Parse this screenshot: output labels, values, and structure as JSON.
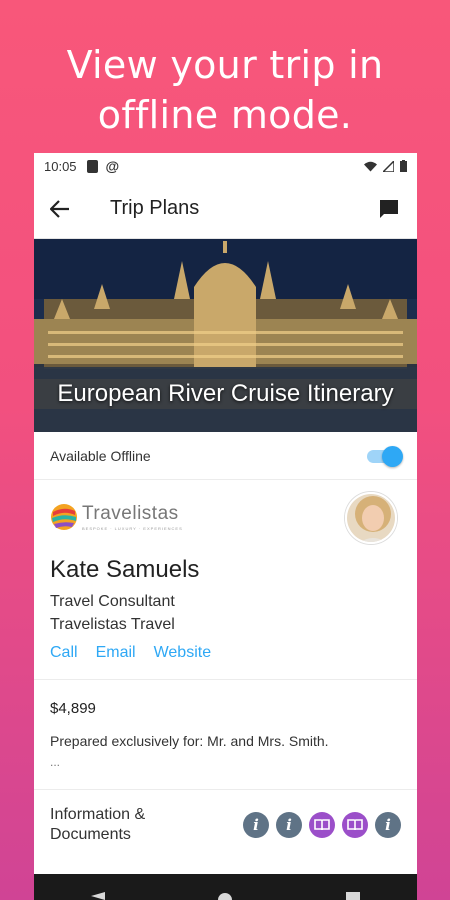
{
  "headline": {
    "line1": "View your trip in",
    "line2": "offline mode."
  },
  "status_bar": {
    "time": "10:05"
  },
  "app_bar": {
    "title": "Trip Plans"
  },
  "hero": {
    "title": "European River Cruise Itinerary"
  },
  "offline": {
    "label": "Available Offline",
    "enabled": true
  },
  "agent": {
    "brand": "Travelistas",
    "tagline": "BESPOKE · LUXURY · EXPERIENCES",
    "name": "Kate Samuels",
    "role": "Travel Consultant",
    "company": "Travelistas Travel",
    "links": {
      "call": "Call",
      "email": "Email",
      "website": "Website"
    }
  },
  "trip": {
    "price": "$4,899",
    "prepared": "Prepared exclusively for: Mr. and Mrs. Smith.",
    "more": "..."
  },
  "info": {
    "label": "Information & Documents",
    "icons": [
      "info-icon",
      "info-icon",
      "book-icon",
      "book-icon",
      "info-icon"
    ]
  },
  "colors": {
    "accent": "#2ea8f5",
    "info_icon": "#5f7386",
    "book_icon": "#9b4fc9"
  }
}
